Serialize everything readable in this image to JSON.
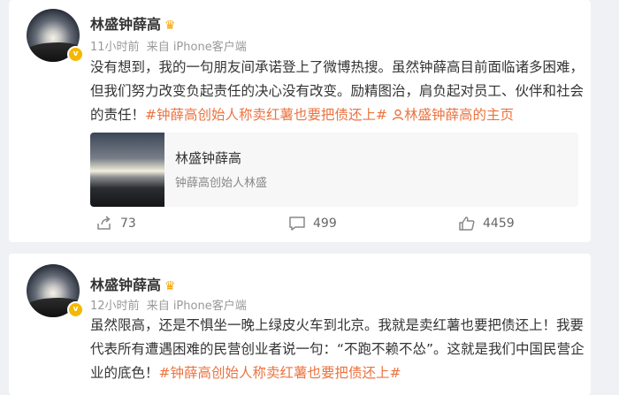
{
  "posts": [
    {
      "author": "林盛钟薛高",
      "time": "11小时前",
      "source": "来自 iPhone客户端",
      "text_plain": "没有想到，我的一句朋友间承诺登上了微博热搜。虽然钟薛高目前面临诸多困难，但我们努力改变负起责任的决心没有改变。励精图治，肩负起对员工、伙伴和社会的责任！",
      "topic": "#钟薛高创始人称卖红薯也要把债还上#",
      "profile_link": "林盛钟薛高的主页",
      "embed": {
        "title": "林盛钟薛高",
        "subtitle": "钟薛高创始人林盛"
      },
      "reposts": "73",
      "comments": "499",
      "likes": "4459"
    },
    {
      "author": "林盛钟薛高",
      "time": "12小时前",
      "source": "来自 iPhone客户端",
      "text_plain": "虽然限高，还是不惧坐一晚上绿皮火车到北京。我就是卖红薯也要把债还上！我要代表所有遭遇困难的民营创业者说一句：“不跑不赖不怂”。这就是我们中国民营企业的底色！",
      "topic": "#钟薛高创始人称卖红薯也要把债还上#"
    }
  ],
  "colors": {
    "topic": "#eb7340",
    "verified": "#f5b800",
    "background": "#f0f1f4"
  },
  "icons": {
    "repost": "share-icon",
    "comment": "comment-icon",
    "like": "thumbs-up-icon",
    "crown": "crown-icon"
  }
}
